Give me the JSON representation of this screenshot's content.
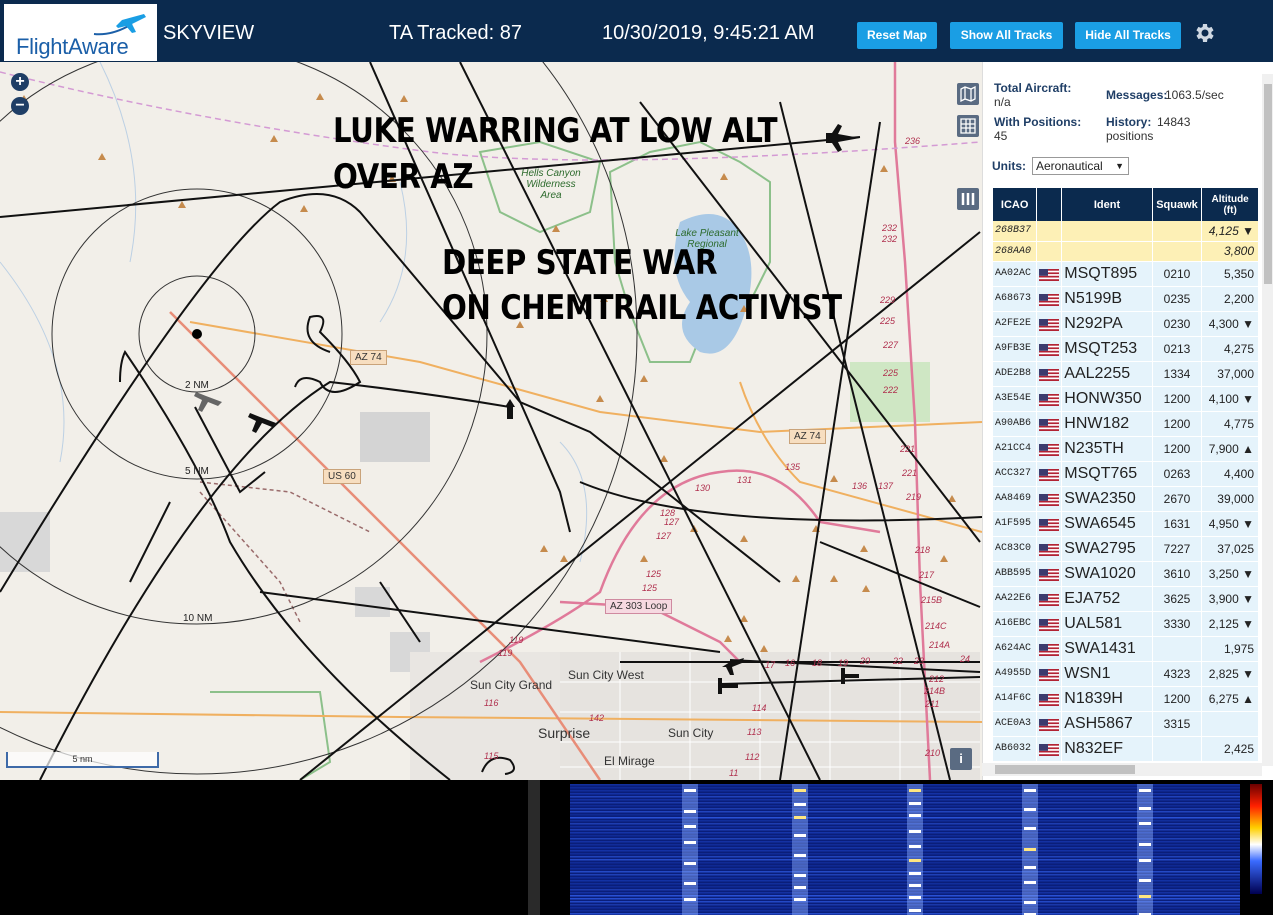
{
  "header": {
    "logo_text": "FlightAware",
    "app_name": "SKYVIEW",
    "tracked_label": "TA Tracked: 87",
    "datetime": "10/30/2019, 9:45:21 AM",
    "buttons": {
      "reset_map": "Reset Map",
      "show_all": "Show All Tracks",
      "hide_all": "Hide All Tracks"
    },
    "settings_icon": "gear-icon"
  },
  "map": {
    "overlay_text": {
      "line1": "LUKE WARRING AT LOW ALT",
      "line2": "OVER AZ",
      "line3": "DEEP STATE WAR",
      "line4": "ON CHEMTRAIL ACTIVIST"
    },
    "ring_labels": {
      "r2": "2 NM",
      "r5": "5 NM",
      "r10": "10 NM"
    },
    "places": {
      "hells_canyon": "Hells Canyon Wilderness Area",
      "lake_pleasant": "Lake Pleasant Regional",
      "sun_city_grand": "Sun City Grand",
      "sun_city_west": "Sun City West",
      "surprise": "Surprise",
      "sun_city": "Sun City",
      "el_mirage": "El Mirage"
    },
    "shields": {
      "az74a": "AZ 74",
      "az74b": "AZ 74",
      "us60": "US 60",
      "az303": "AZ 303 Loop"
    },
    "route_numbers": [
      "236",
      "232",
      "232",
      "229",
      "225",
      "227",
      "225",
      "222",
      "221",
      "221",
      "219",
      "218",
      "217",
      "215B",
      "214C",
      "214A",
      "214B",
      "212",
      "211",
      "210",
      "135",
      "131",
      "130",
      "136",
      "137",
      "128",
      "127",
      "127",
      "125",
      "125",
      "119",
      "119",
      "116",
      "115",
      "114",
      "113",
      "112",
      "11",
      "17",
      "16",
      "18",
      "19",
      "20",
      "22",
      "23",
      "24",
      "142"
    ],
    "scale_label": "5 nm",
    "zoom_in": "+",
    "zoom_out": "−",
    "info_label": "i"
  },
  "sidebar": {
    "total_aircraft_label": "Total Aircraft:",
    "total_aircraft_value": "n/a",
    "messages_label": "Messages:",
    "messages_value": "1063.5/sec",
    "with_positions_label": "With Positions:",
    "with_positions_value": "45",
    "history_label": "History:",
    "history_value": "14843",
    "history_unit": "positions",
    "units_label": "Units:",
    "units_value": "Aeronautical",
    "columns": {
      "icao": "ICAO",
      "ident": "Ident",
      "squawk": "Squawk",
      "altitude": "Altitude",
      "altitude_unit": "(ft)"
    },
    "rows": [
      {
        "icao": "268B37",
        "ident": "",
        "squawk": "",
        "alt": "4,125 ▼",
        "sel": true
      },
      {
        "icao": "268AA0",
        "ident": "",
        "squawk": "",
        "alt": "3,800",
        "sel": true
      },
      {
        "icao": "AA02AC",
        "ident": "MSQT895",
        "squawk": "0210",
        "alt": "5,350"
      },
      {
        "icao": "A68673",
        "ident": "N5199B",
        "squawk": "0235",
        "alt": "2,200"
      },
      {
        "icao": "A2FE2E",
        "ident": "N292PA",
        "squawk": "0230",
        "alt": "4,300 ▼"
      },
      {
        "icao": "A9FB3E",
        "ident": "MSQT253",
        "squawk": "0213",
        "alt": "4,275"
      },
      {
        "icao": "ADE2B8",
        "ident": "AAL2255",
        "squawk": "1334",
        "alt": "37,000"
      },
      {
        "icao": "A3E54E",
        "ident": "HONW350",
        "squawk": "1200",
        "alt": "4,100 ▼"
      },
      {
        "icao": "A90AB6",
        "ident": "HNW182",
        "squawk": "1200",
        "alt": "4,775"
      },
      {
        "icao": "A21CC4",
        "ident": "N235TH",
        "squawk": "1200",
        "alt": "7,900 ▲"
      },
      {
        "icao": "ACC327",
        "ident": "MSQT765",
        "squawk": "0263",
        "alt": "4,400"
      },
      {
        "icao": "AA8469",
        "ident": "SWA2350",
        "squawk": "2670",
        "alt": "39,000"
      },
      {
        "icao": "A1F595",
        "ident": "SWA6545",
        "squawk": "1631",
        "alt": "4,950 ▼"
      },
      {
        "icao": "AC83C0",
        "ident": "SWA2795",
        "squawk": "7227",
        "alt": "37,025"
      },
      {
        "icao": "ABB595",
        "ident": "SWA1020",
        "squawk": "3610",
        "alt": "3,250 ▼"
      },
      {
        "icao": "AA22E6",
        "ident": "EJA752",
        "squawk": "3625",
        "alt": "3,900 ▼"
      },
      {
        "icao": "A16EBC",
        "ident": "UAL581",
        "squawk": "3330",
        "alt": "2,125 ▼"
      },
      {
        "icao": "A624AC",
        "ident": "SWA1431",
        "squawk": "",
        "alt": "1,975"
      },
      {
        "icao": "A4955D",
        "ident": "WSN1",
        "squawk": "4323",
        "alt": "2,825 ▼"
      },
      {
        "icao": "A14F6C",
        "ident": "N1839H",
        "squawk": "1200",
        "alt": "6,275 ▲"
      },
      {
        "icao": "ACE0A3",
        "ident": "ASH5867",
        "squawk": "3315",
        "alt": ""
      },
      {
        "icao": "AB6032",
        "ident": "N832EF",
        "squawk": "",
        "alt": "2,425"
      }
    ]
  },
  "colors": {
    "header_bg": "#0b2a4e",
    "button_bg": "#1a9ee4",
    "row_bg": "#e5f3fb",
    "selected_row_bg": "#fdf0b6"
  }
}
